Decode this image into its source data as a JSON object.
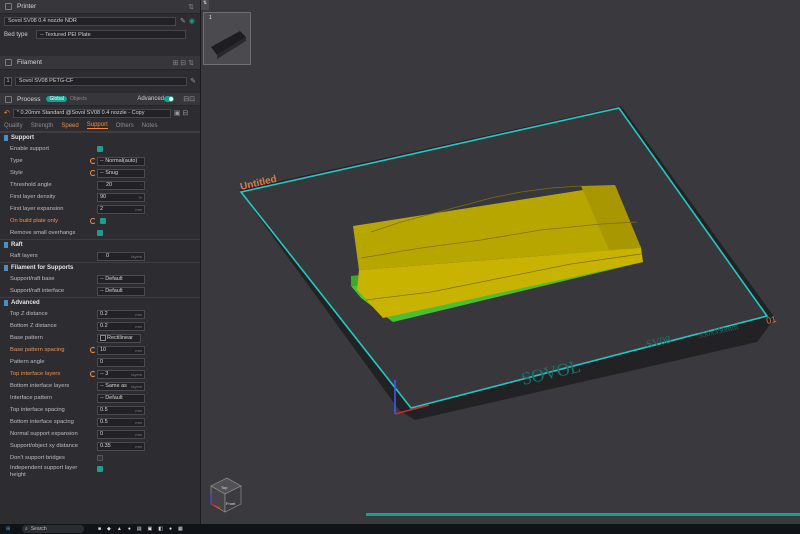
{
  "printer": {
    "header": "Printer",
    "name": "Sovol SV08 0.4 nozzle NDR",
    "bed_type_label": "Bed type",
    "bed_type_value": "-- Textured PEI Plate"
  },
  "filament": {
    "header": "Filament",
    "slot": "1",
    "name": "Sovol SV08 PETG-CF"
  },
  "process": {
    "header": "Process",
    "global": "Global",
    "objects": "Objects",
    "advanced": "Advanced",
    "preset": "* 0.20mm Standard @Sovol SV08 0.4 nozzle - Copy",
    "tabs": [
      "Quality",
      "Strength",
      "Speed",
      "Support",
      "Others",
      "Notes"
    ]
  },
  "groups": {
    "support": "Support",
    "raft": "Raft",
    "filament_supports": "Filament for Supports",
    "advanced": "Advanced"
  },
  "params": {
    "enable_support": "Enable support",
    "type": "Type",
    "type_val": "-- Normal(auto)",
    "style": "Style",
    "style_val": "-- Snug",
    "threshold": "Threshold angle",
    "threshold_val": "20",
    "first_density": "First layer density",
    "first_density_val": "90",
    "first_density_unit": "%",
    "first_expansion": "First layer expansion",
    "first_expansion_val": "2",
    "first_expansion_unit": "mm",
    "on_build_plate": "On build plate only",
    "remove_small": "Remove small overhangs",
    "raft_layers": "Raft layers",
    "raft_layers_val": "0",
    "raft_layers_unit": "layers",
    "support_raft_base": "Support/raft base",
    "support_raft_base_val": "-- Default",
    "support_raft_interface": "Support/raft interface",
    "support_raft_interface_val": "-- Default",
    "top_z": "Top Z distance",
    "top_z_val": "0.2",
    "bottom_z": "Bottom Z distance",
    "bottom_z_val": "0.2",
    "base_pattern": "Base pattern",
    "base_pattern_val": "Rectilinear",
    "base_spacing": "Base pattern spacing",
    "base_spacing_val": "10",
    "pattern_angle": "Pattern angle",
    "pattern_angle_val": "0",
    "top_interface_layers": "Top interface layers",
    "top_interface_layers_val": "-- 3",
    "bottom_interface_layers": "Bottom interface layers",
    "bottom_interface_layers_val": "-- Same as",
    "interface_pattern": "Interface pattern",
    "interface_pattern_val": "-- Default",
    "top_interface_spacing": "Top interface spacing",
    "top_interface_spacing_val": "0.5",
    "bottom_interface_spacing": "Bottom interface spacing",
    "bottom_interface_spacing_val": "0.5",
    "normal_expansion": "Normal support expansion",
    "normal_expansion_val": "0",
    "xy_distance": "Support/object xy distance",
    "xy_distance_val": "0.35",
    "dont_bridges": "Don't support bridges",
    "independent_height_1": "Independent support layer",
    "independent_height_2": "height",
    "unit_mm": "mm",
    "unit_deg": "°",
    "unit_layers": "layers"
  },
  "viewport": {
    "plate_number": "1",
    "plate_name": "Untitled",
    "brand": "SOVOL",
    "model": "SV08",
    "size": "350x350mm",
    "plate_index": "01",
    "cube_top": "Top",
    "cube_front": "Front"
  },
  "taskbar": {
    "search": "Search"
  },
  "colors": {
    "accent": "#1a9e8e",
    "modified": "#f0904a",
    "plate_border": "#22c9c4",
    "model": "#c8b400",
    "support": "#3ea82a"
  }
}
